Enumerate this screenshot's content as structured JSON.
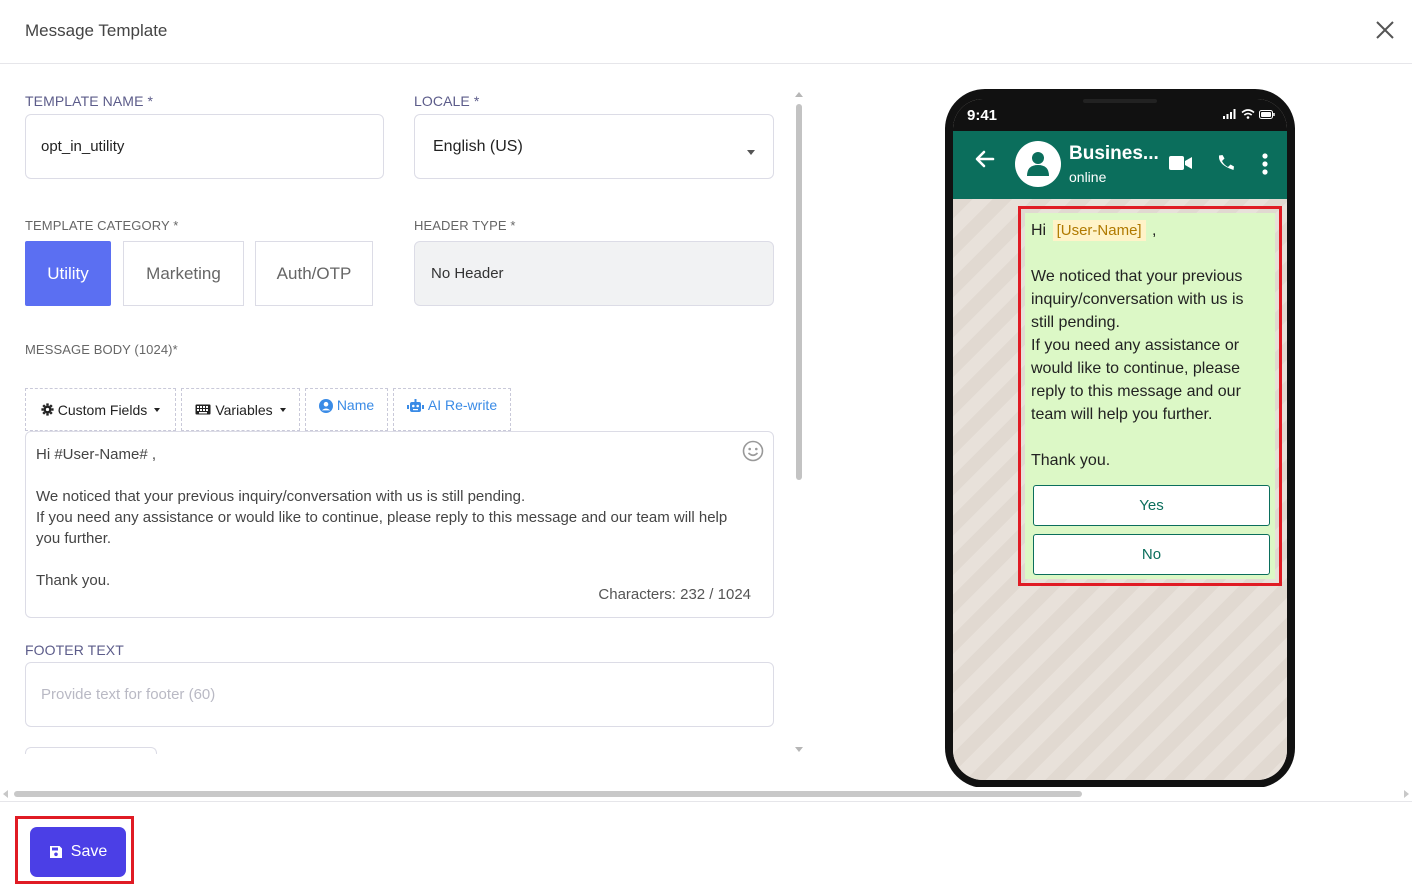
{
  "modal": {
    "title": "Message Template"
  },
  "form": {
    "template_name": {
      "label": "TEMPLATE NAME *",
      "value": "opt_in_utility"
    },
    "locale": {
      "label": "LOCALE *",
      "value": "English (US)"
    },
    "category": {
      "label": "TEMPLATE CATEGORY *",
      "options": [
        "Utility",
        "Marketing",
        "Auth/OTP"
      ],
      "selected": "Utility"
    },
    "header_type": {
      "label": "HEADER TYPE *",
      "value": "No Header"
    },
    "message_body": {
      "label": "MESSAGE BODY (1024)*",
      "toolbar": {
        "custom_fields": "Custom Fields",
        "variables": "Variables",
        "name": "Name",
        "ai_rewrite": "AI Re-write"
      },
      "lines": [
        "Hi #User-Name# ,",
        "",
        "We noticed that your previous inquiry/conversation with us is still pending.",
        "If you need any assistance or would like to continue, please reply to this message and our team will help you further.",
        "",
        "Thank you."
      ],
      "char_count": "Characters: 232 / 1024"
    },
    "footer": {
      "label": "FOOTER TEXT",
      "placeholder": "Provide text for footer (60)"
    }
  },
  "footer_bar": {
    "save_label": "Save"
  },
  "preview": {
    "time": "9:41",
    "business_name": "Busines...",
    "status": "online",
    "message": {
      "greeting_prefix": "Hi",
      "variable": "[User-Name]",
      "greeting_suffix": ",",
      "line1": "We noticed that your previous inquiry/conversation with us is still pending.",
      "line2": "If you need any assistance or would like to continue, please reply to this message and our team will help you further.",
      "closing": "Thank you."
    },
    "buttons": [
      "Yes",
      "No"
    ]
  },
  "colors": {
    "accent": "#5b6ff2",
    "save_button": "#4b3fe6",
    "whatsapp_header": "#0b6e5c",
    "bubble": "#dcf8c6",
    "highlight": "#e01b24"
  }
}
